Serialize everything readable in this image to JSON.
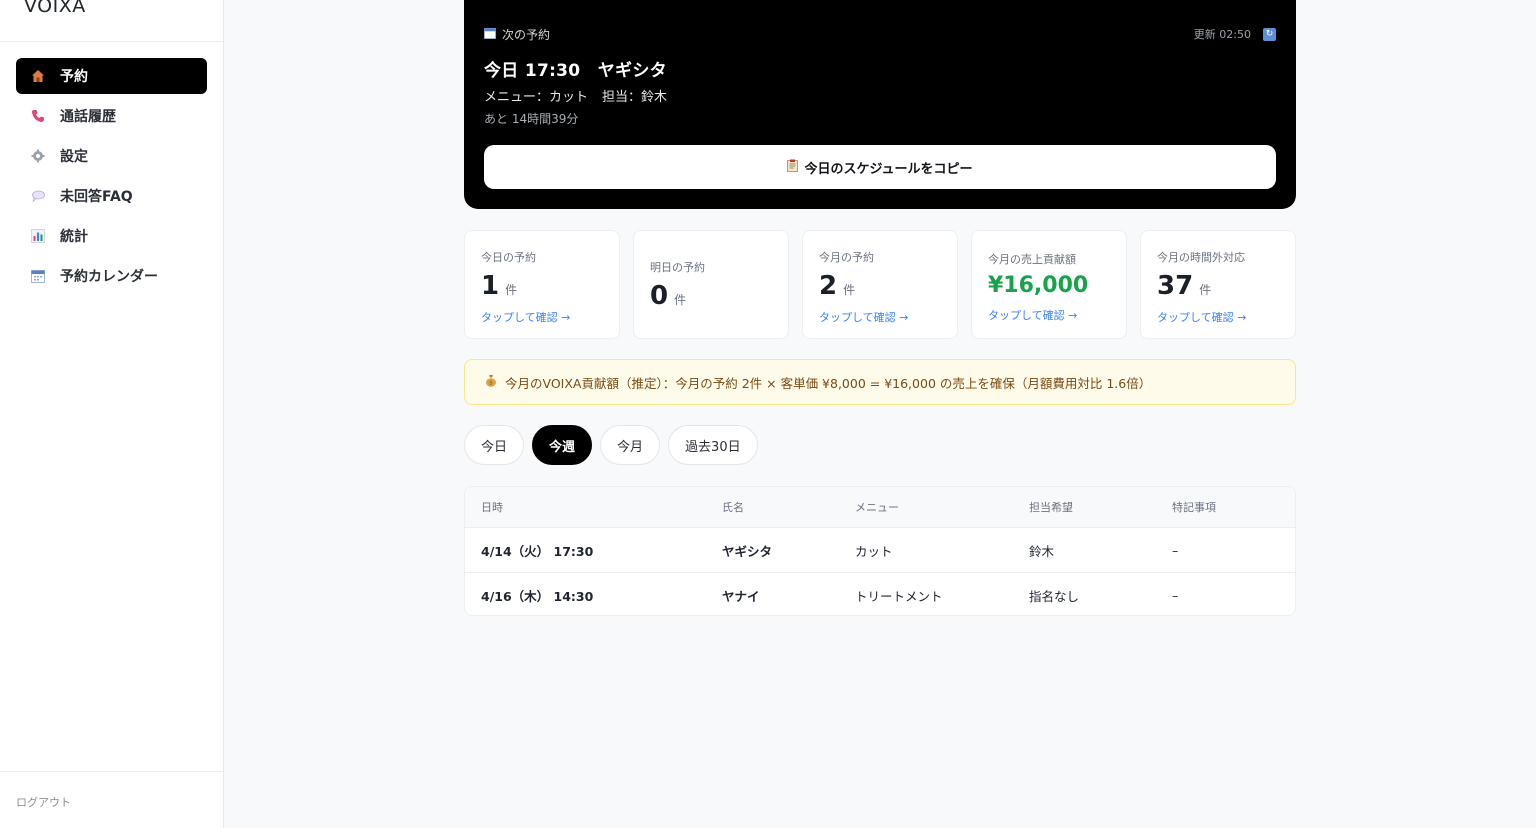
{
  "app": {
    "brand": "VOIXA",
    "logout": "ログアウト"
  },
  "sidebar": {
    "items": [
      {
        "label": "予約",
        "icon": "house-icon",
        "active": true
      },
      {
        "label": "通話履歴",
        "icon": "phone-icon"
      },
      {
        "label": "設定",
        "icon": "gear-icon"
      },
      {
        "label": "未回答FAQ",
        "icon": "speech-bubble-icon"
      },
      {
        "label": "統計",
        "icon": "bar-chart-icon"
      },
      {
        "label": "予約カレンダー",
        "icon": "calendar-icon"
      }
    ]
  },
  "next": {
    "heading": "次の予約",
    "updated": "更新 02:50",
    "title": "今日 17:30　ヤギシタ",
    "menu": "メニュー：カット",
    "staff": "担当：鈴木",
    "remaining": "あと 14時間39分",
    "copy_label": "今日のスケジュールをコピー"
  },
  "stats": [
    {
      "label": "今日の予約",
      "value": "1",
      "unit": "件",
      "link": "タップして確認 →"
    },
    {
      "label": "明日の予約",
      "value": "0",
      "unit": "件",
      "link": ""
    },
    {
      "label": "今月の予約",
      "value": "2",
      "unit": "件",
      "link": "タップして確認 →"
    },
    {
      "label": "今月の売上貢献額",
      "value": "¥16,000",
      "unit": "",
      "link": "タップして確認 →"
    },
    {
      "label": "今月の時間外対応",
      "value": "37",
      "unit": "件",
      "link": "タップして確認 →"
    }
  ],
  "banner": "今月のVOIXA貢献額（推定）：今月の予約 2件 × 客単価 ¥8,000 = ¥16,000 の売上を確保（月額費用対比 1.6倍）",
  "tabs": [
    "今日",
    "今週",
    "今月",
    "過去30日"
  ],
  "active_tab": "今週",
  "table": {
    "headers": [
      "日時",
      "氏名",
      "メニュー",
      "担当希望",
      "特記事項"
    ],
    "rows": [
      [
        "4/14（火） 17:30",
        "ヤギシタ",
        "カット",
        "鈴木",
        "–"
      ],
      [
        "4/16（木） 14:30",
        "ヤナイ",
        "トリートメント",
        "指名なし",
        "–"
      ]
    ]
  },
  "colors": {
    "accent_green": "#16a34a",
    "link_blue": "#3b82f6",
    "banner_bg": "#fffbeb"
  }
}
